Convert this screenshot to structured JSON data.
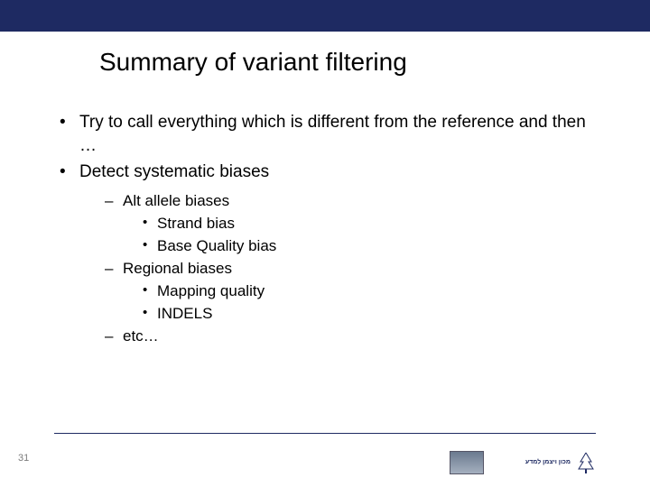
{
  "title": "Summary of variant filtering",
  "bullets": {
    "b1": "Try to call everything which is different from the reference and then …",
    "b2": "Detect systematic biases",
    "b2_sub": {
      "s1": "Alt allele biases",
      "s1_sub": {
        "a": "Strand bias",
        "b": "Base Quality bias"
      },
      "s2": "Regional biases",
      "s2_sub": {
        "a": "Mapping quality",
        "b": "INDELS"
      },
      "s3": "etc…"
    }
  },
  "page_number": "31",
  "logo": {
    "line1": "מכון ויצמן למדע"
  }
}
